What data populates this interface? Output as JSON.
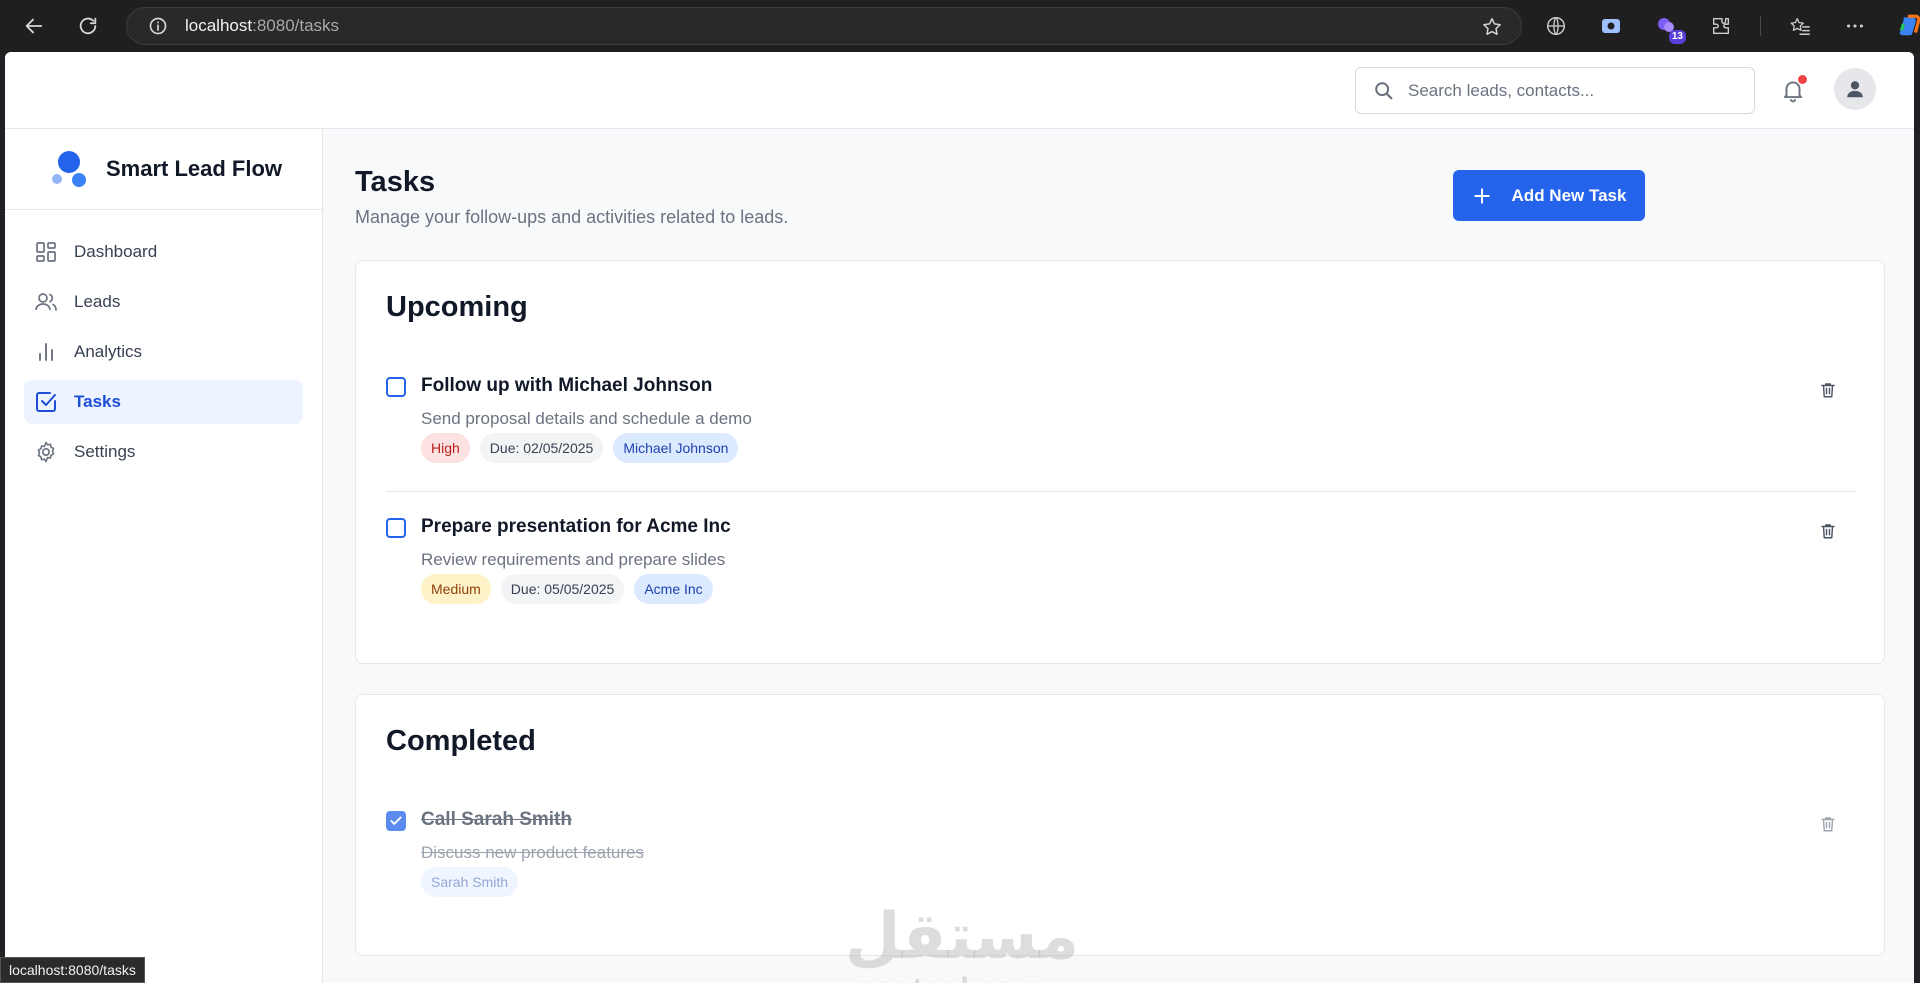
{
  "browser": {
    "url_host": "localhost",
    "url_path": ":8080/tasks",
    "extension_badge": "13",
    "status_url": "localhost:8080/tasks"
  },
  "header": {
    "search_placeholder": "Search leads, contacts..."
  },
  "sidebar": {
    "brand": "Smart Lead Flow",
    "items": [
      {
        "label": "Dashboard",
        "icon": "dashboard-icon"
      },
      {
        "label": "Leads",
        "icon": "users-icon"
      },
      {
        "label": "Analytics",
        "icon": "bar-chart-icon"
      },
      {
        "label": "Tasks",
        "icon": "check-square-icon",
        "active": true
      },
      {
        "label": "Settings",
        "icon": "gear-icon"
      }
    ]
  },
  "main": {
    "title": "Tasks",
    "subtitle": "Manage your follow-ups and activities related to leads.",
    "add_button": "Add New Task",
    "upcoming": {
      "title": "Upcoming",
      "tasks": [
        {
          "title": "Follow up with Michael Johnson",
          "description": "Send proposal details and schedule a demo",
          "priority": "High",
          "due": "Due: 02/05/2025",
          "contact": "Michael Johnson",
          "completed": false
        },
        {
          "title": "Prepare presentation for Acme Inc",
          "description": "Review requirements and prepare slides",
          "priority": "Medium",
          "due": "Due: 05/05/2025",
          "contact": "Acme Inc",
          "completed": false
        }
      ]
    },
    "completed": {
      "title": "Completed",
      "tasks": [
        {
          "title": "Call Sarah Smith",
          "description": "Discuss new product features",
          "contact": "Sarah Smith",
          "completed": true
        }
      ]
    }
  },
  "watermark": {
    "arabic": "مستقل",
    "latin": "mostaql.com"
  },
  "colors": {
    "accent": "#2563eb",
    "active_bg": "#eef4ff",
    "high": "#fde2e2",
    "medium": "#fef3c7",
    "contact": "#dbeafe",
    "notification_dot": "#ef4444"
  }
}
